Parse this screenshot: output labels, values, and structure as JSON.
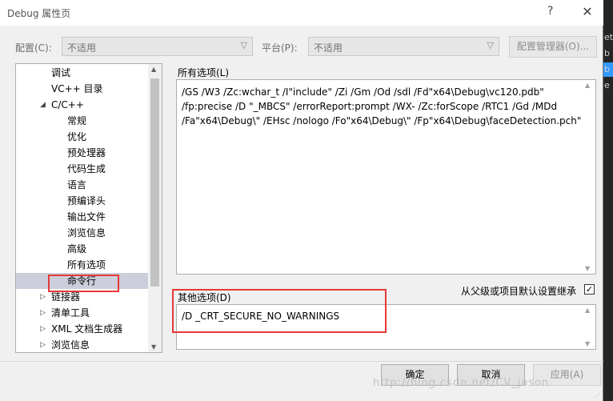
{
  "window": {
    "title": "Debug 属性页",
    "help": "?",
    "close": "✕"
  },
  "toolbar": {
    "config_label": "配置(C):",
    "config_value": "不适用",
    "platform_label": "平台(P):",
    "platform_value": "不适用",
    "config_manager_button": "配置管理器(O)..."
  },
  "tree": {
    "items": [
      {
        "label": "调试",
        "level": 1,
        "expander": ""
      },
      {
        "label": "VC++ 目录",
        "level": 1,
        "expander": ""
      },
      {
        "label": "C/C++",
        "level": 1,
        "expander": "◢"
      },
      {
        "label": "常规",
        "level": 2,
        "expander": ""
      },
      {
        "label": "优化",
        "level": 2,
        "expander": ""
      },
      {
        "label": "预处理器",
        "level": 2,
        "expander": ""
      },
      {
        "label": "代码生成",
        "level": 2,
        "expander": ""
      },
      {
        "label": "语言",
        "level": 2,
        "expander": ""
      },
      {
        "label": "预编译头",
        "level": 2,
        "expander": ""
      },
      {
        "label": "输出文件",
        "level": 2,
        "expander": ""
      },
      {
        "label": "浏览信息",
        "level": 2,
        "expander": ""
      },
      {
        "label": "高级",
        "level": 2,
        "expander": ""
      },
      {
        "label": "所有选项",
        "level": 2,
        "expander": ""
      },
      {
        "label": "命令行",
        "level": 2,
        "expander": "",
        "selected": true
      },
      {
        "label": "链接器",
        "level": 1,
        "expander": "▷"
      },
      {
        "label": "清单工具",
        "level": 1,
        "expander": "▷"
      },
      {
        "label": "XML 文档生成器",
        "level": 1,
        "expander": "▷"
      },
      {
        "label": "浏览信息",
        "level": 1,
        "expander": "▷"
      }
    ]
  },
  "all_options": {
    "label": "所有选项(L)",
    "text": "/GS /W3 /Zc:wchar_t /I\"include\" /Zi /Gm /Od /sdl /Fd\"x64\\Debug\\vc120.pdb\"\n/fp:precise /D \"_MBCS\" /errorReport:prompt /WX- /Zc:forScope /RTC1 /Gd /MDd\n/Fa\"x64\\Debug\\\" /EHsc /nologo /Fo\"x64\\Debug\\\" /Fp\"x64\\Debug\\faceDetection.pch\""
  },
  "inherit": {
    "label": "从父级或项目默认设置继承",
    "checked": "✓"
  },
  "other_options": {
    "label": "其他选项(D)",
    "value": "/D _CRT_SECURE_NO_WARNINGS"
  },
  "buttons": {
    "ok": "确定",
    "cancel": "取消",
    "apply": "应用(A)"
  },
  "watermark": "http://blog.csdn.net/CV_jason",
  "background_fragments": [
    "et",
    "b",
    "b",
    "e"
  ],
  "colors": {
    "highlight_box": "#e53935",
    "selected_row": "#cccedb",
    "background_selection": "#3399ff"
  }
}
